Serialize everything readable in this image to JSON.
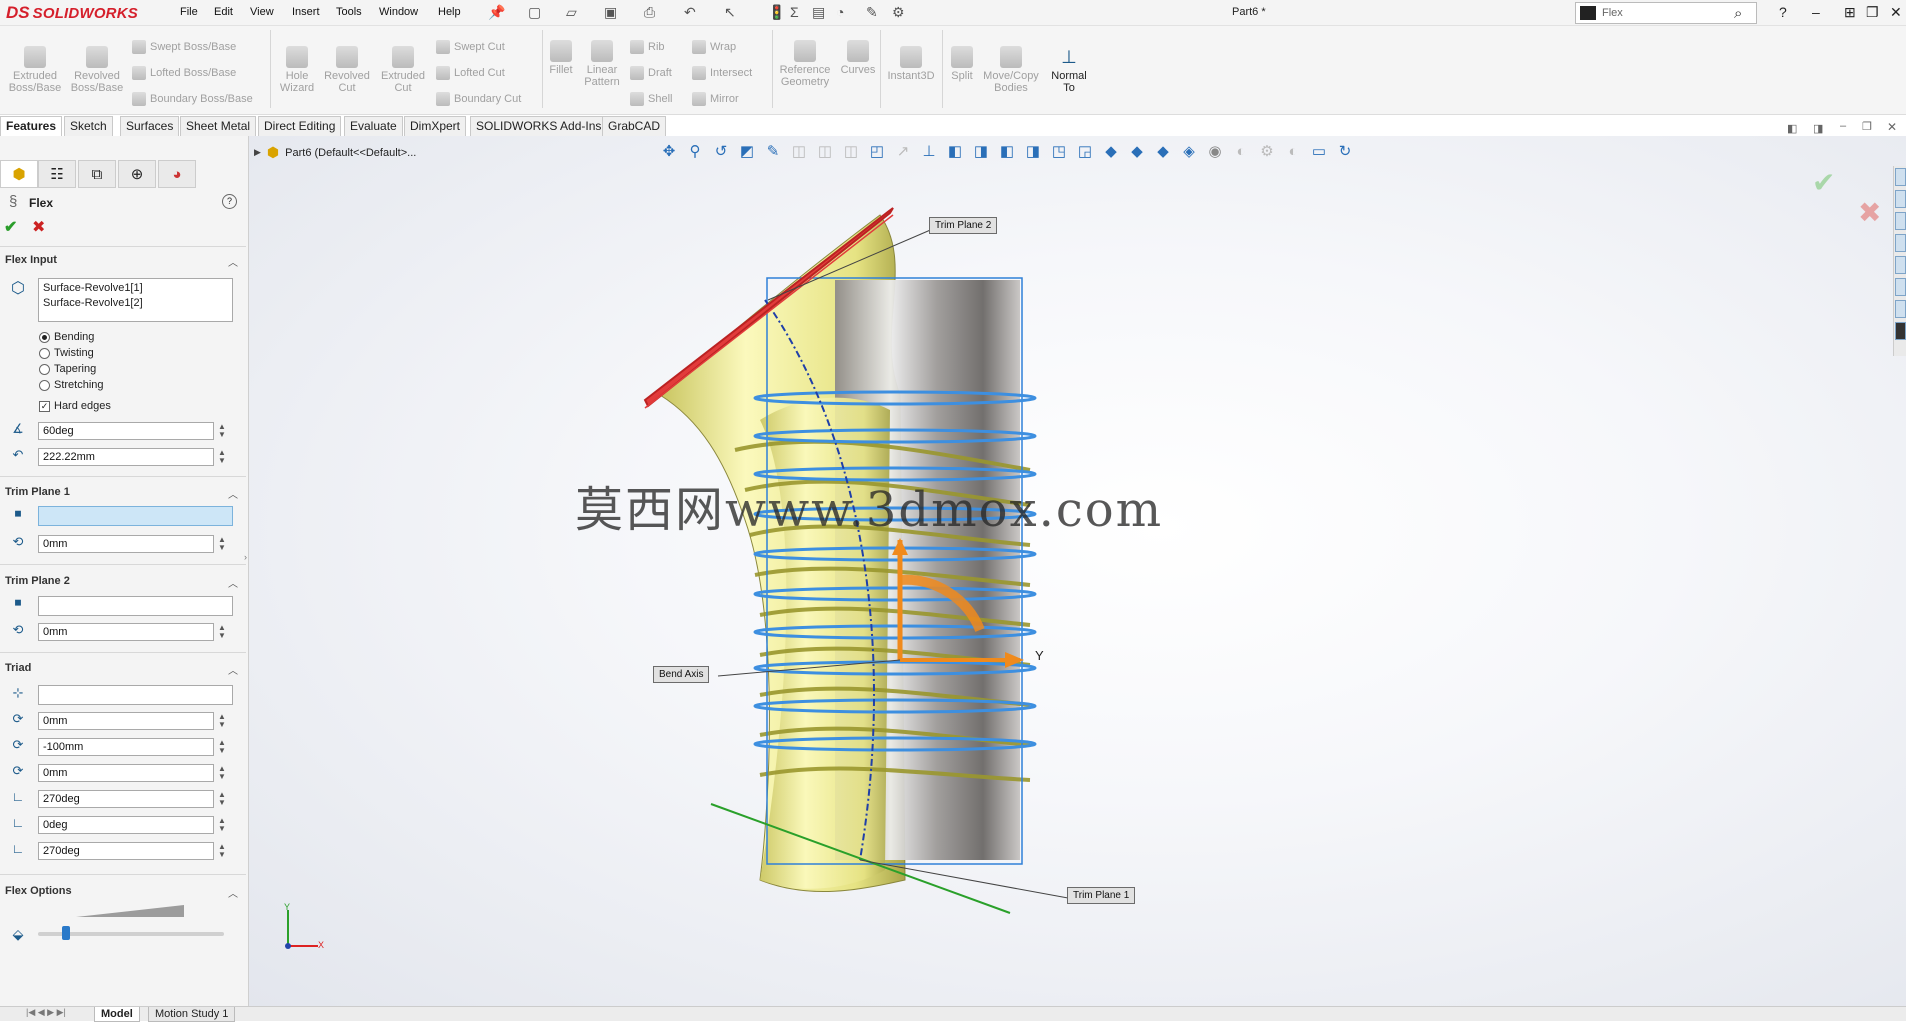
{
  "app": {
    "logo_ds": "DS",
    "logo_name": "SOLIDWORKS",
    "document_title": "Part6 *"
  },
  "menu": [
    "File",
    "Edit",
    "View",
    "Insert",
    "Tools",
    "Window",
    "Help"
  ],
  "search": {
    "value": "Flex"
  },
  "toolbar": {
    "extruded_boss": [
      "Extruded",
      "Boss/Base"
    ],
    "revolved_boss": [
      "Revolved",
      "Boss/Base"
    ],
    "swept_boss": "Swept Boss/Base",
    "lofted_boss": "Lofted Boss/Base",
    "boundary_boss": "Boundary Boss/Base",
    "hole_wizard": [
      "Hole",
      "Wizard"
    ],
    "revolved_cut": [
      "Revolved",
      "Cut"
    ],
    "extruded_cut": [
      "Extruded",
      "Cut"
    ],
    "swept_cut": "Swept Cut",
    "lofted_cut": "Lofted Cut",
    "boundary_cut": "Boundary Cut",
    "fillet": "Fillet",
    "linear_pattern": [
      "Linear",
      "Pattern"
    ],
    "rib": "Rib",
    "draft": "Draft",
    "shell": "Shell",
    "wrap": "Wrap",
    "intersect": "Intersect",
    "mirror": "Mirror",
    "reference_geometry": [
      "Reference",
      "Geometry"
    ],
    "curves": "Curves",
    "instant3d": "Instant3D",
    "split": "Split",
    "move_copy_bodies": [
      "Move/Copy",
      "Bodies"
    ],
    "normal_to": [
      "Normal",
      "To"
    ]
  },
  "tabs": [
    "Features",
    "Sketch",
    "Surfaces",
    "Sheet Metal",
    "Direct Editing",
    "Evaluate",
    "DimXpert",
    "SOLIDWORKS Add-Ins",
    "GrabCAD"
  ],
  "tree": {
    "part_label": "Part6  (Default<<Default>..."
  },
  "property_manager": {
    "title": "Flex",
    "flex_input": {
      "header": "Flex Input",
      "bodies": [
        "Surface-Revolve1[1]",
        "Surface-Revolve1[2]"
      ],
      "modes": [
        "Bending",
        "Twisting",
        "Tapering",
        "Stretching"
      ],
      "selected_mode": "Bending",
      "hard_edges_label": "Hard edges",
      "hard_edges_checked": true,
      "angle": "60deg",
      "radius": "222.22mm"
    },
    "trim_plane_1": {
      "header": "Trim Plane 1",
      "selection": "",
      "offset": "0mm"
    },
    "trim_plane_2": {
      "header": "Trim Plane 2",
      "selection": "",
      "offset": "0mm"
    },
    "triad": {
      "header": "Triad",
      "selection": "",
      "x": "0mm",
      "y": "-100mm",
      "z": "0mm",
      "rx": "270deg",
      "ry": "0deg",
      "rz": "270deg"
    },
    "flex_options": {
      "header": "Flex Options",
      "accuracy_level": 0.15
    }
  },
  "callouts": {
    "trim_plane_2": "Trim Plane 2",
    "trim_plane_1": "Trim Plane 1",
    "bend_axis": "Bend Axis",
    "triad_y": "Y"
  },
  "watermark": "莫西网www.3dmox.com",
  "bottom_tabs": [
    "Model",
    "Motion Study 1"
  ],
  "axis_labels": {
    "y": "Y",
    "x": "X"
  },
  "colors": {
    "accent": "#d51f2b",
    "selection_blue": "#2f80d8",
    "model_yellow": "#e8e58a",
    "trim2": "#e23b3b",
    "trim1": "#2aa02a",
    "triad_orange": "#f08a1c"
  }
}
